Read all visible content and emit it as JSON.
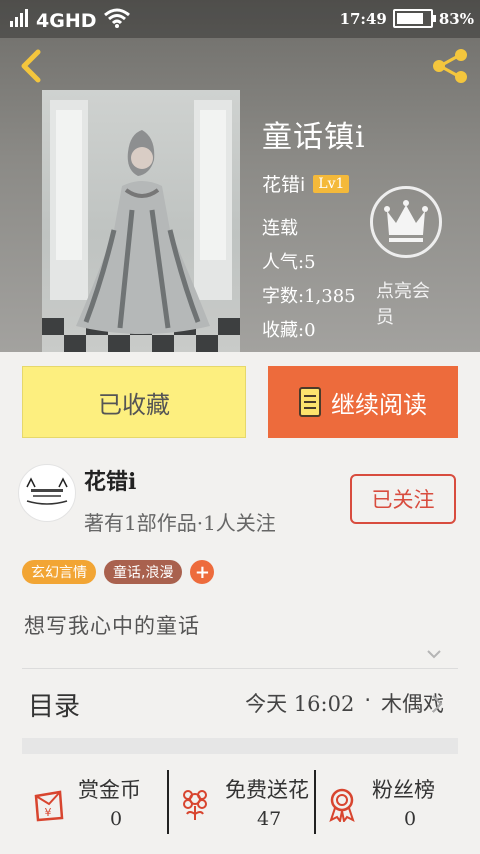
{
  "status_bar": {
    "signal": "1",
    "network": "4GHD",
    "time": "17:49",
    "battery": "83%",
    "battery_level": 0.83
  },
  "book": {
    "title": "童话镇i",
    "author": "花错i",
    "level": "Lv1",
    "status": "连载",
    "popularity": "人气:5",
    "word_count": "字数:1,385",
    "favorites": "收藏:0"
  },
  "membership": {
    "label": "点亮会员"
  },
  "actions": {
    "favorited_label": "已收藏",
    "continue_label": "继续阅读"
  },
  "author_card": {
    "name": "花错i",
    "stats": "著有1部作品·1人关注",
    "follow_label": "已关注"
  },
  "tags": [
    {
      "label": "玄幻言情",
      "color": "#f2a534"
    },
    {
      "label": "童话,浪漫",
      "color": "#a9614e"
    }
  ],
  "intro": "想写我心中的童话",
  "toc": {
    "label": "目录",
    "latest_time": "今天 16:02",
    "latest_sep": "·",
    "latest_title": "木偶戏"
  },
  "stats": [
    {
      "label": "赏金币",
      "value": "0"
    },
    {
      "label": "免费送花",
      "value": "47"
    },
    {
      "label": "粉丝榜",
      "value": "0"
    }
  ],
  "colors": {
    "accent_orange": "#ed6b3c",
    "fav_yellow": "#fdef7f",
    "follow_red": "#d84c3e",
    "level_badge": "#f4b93a"
  }
}
